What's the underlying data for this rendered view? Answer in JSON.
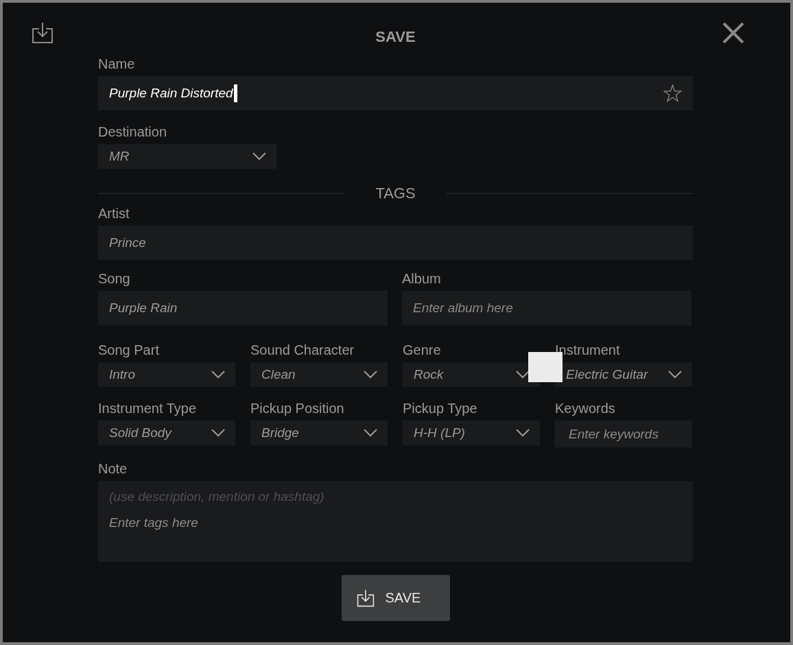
{
  "title": "SAVE",
  "name_field": {
    "label": "Name",
    "value": "Purple Rain Distorted",
    "favorite": false
  },
  "destination": {
    "label": "Destination",
    "value": "MR"
  },
  "tags_heading": "TAGS",
  "artist": {
    "label": "Artist",
    "value": "Prince"
  },
  "song": {
    "label": "Song",
    "value": "Purple Rain"
  },
  "album": {
    "label": "Album",
    "placeholder": "Enter album here"
  },
  "tag_fields": [
    {
      "kind": "select",
      "label": "Song Part",
      "value": "Intro"
    },
    {
      "kind": "select",
      "label": "Sound Character",
      "value": "Clean"
    },
    {
      "kind": "select",
      "label": "Genre",
      "value": "Rock"
    },
    {
      "kind": "select",
      "label": "Instrument",
      "value": "Electric Guitar"
    },
    {
      "kind": "select",
      "label": "Instrument Type",
      "value": "Solid Body"
    },
    {
      "kind": "select",
      "label": "Pickup Position",
      "value": "Bridge"
    },
    {
      "kind": "select",
      "label": "Pickup Type",
      "value": "H-H (LP)"
    },
    {
      "kind": "input",
      "label": "Keywords",
      "placeholder": "Enter keywords"
    }
  ],
  "note": {
    "label": "Note",
    "hint": "(use description, mention or hashtag)",
    "placeholder": "Enter tags here"
  },
  "save_button": "SAVE"
}
